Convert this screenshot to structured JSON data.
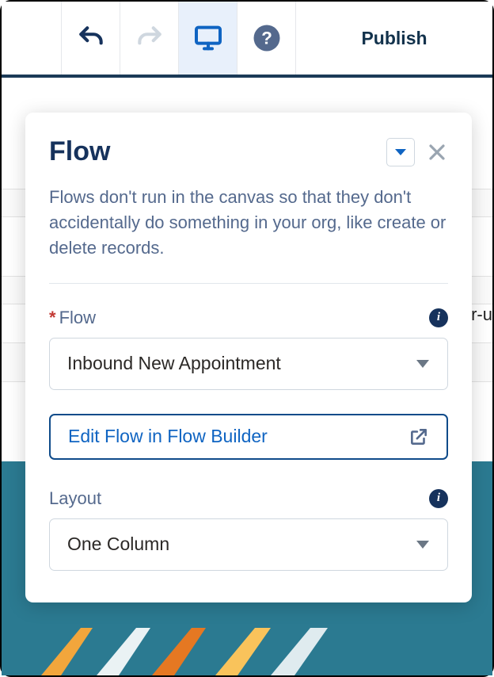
{
  "toolbar": {
    "publish_label": "Publish"
  },
  "panel": {
    "title": "Flow",
    "description": "Flows don't run in the canvas so that they don't accidentally do something in your org, like create or delete records.",
    "flow_field": {
      "label": "Flow",
      "required_marker": "*",
      "value": "Inbound New Appointment"
    },
    "edit_link": "Edit Flow in Flow Builder",
    "layout_field": {
      "label": "Layout",
      "value": "One Column"
    }
  },
  "background": {
    "partial_text": "r-u"
  }
}
